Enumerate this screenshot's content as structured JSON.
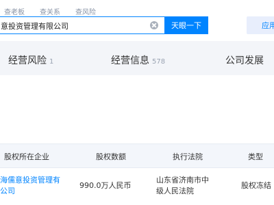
{
  "header": {
    "subtabs": [
      "查老板",
      "查关系",
      "查风险"
    ],
    "search_value": "意投资管理有限公司",
    "search_button": "天眼一下",
    "app_button": "应用"
  },
  "main_tabs": [
    {
      "label": "经营风险",
      "count": "1"
    },
    {
      "label": "经营信息",
      "count": "578"
    },
    {
      "label": "公司发展",
      "count": ""
    }
  ],
  "table": {
    "columns": [
      "股权所在企业",
      "股权数额",
      "执行法院",
      "类型"
    ],
    "rows": [
      {
        "company_line1": "海儒意投资管理有",
        "company_line2": "公司",
        "amount": "990.0万人民币",
        "court_line1": "山东省济南市中",
        "court_line2": "级人民法院",
        "type": "股权冻结"
      }
    ]
  },
  "colors": {
    "accent": "#0084ff",
    "header_bg": "#f3f6fb"
  }
}
